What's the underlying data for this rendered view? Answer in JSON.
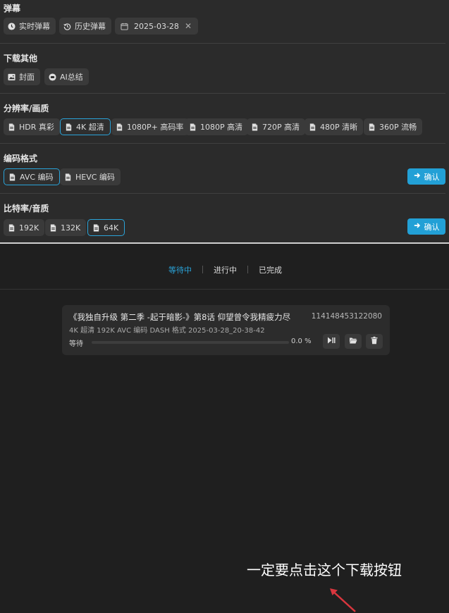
{
  "danmaku": {
    "title": "弹幕",
    "realtime_label": "实时弹幕",
    "history_label": "历史弹幕",
    "date_value": "2025-03-28"
  },
  "download_other": {
    "title": "下载其他",
    "cover_label": "封面",
    "ai_summary_label": "AI总结"
  },
  "resolution": {
    "title": "分辨率/画质",
    "options": [
      "HDR 真彩",
      "4K 超清",
      "1080P+ 高码率",
      "1080P 高清",
      "720P 高清",
      "480P 清晰",
      "360P 流畅"
    ],
    "selected": "4K 超清"
  },
  "codec": {
    "title": "编码格式",
    "options": [
      "AVC 编码",
      "HEVC 编码"
    ],
    "selected": "AVC 编码",
    "confirm_label": "确认"
  },
  "bitrate": {
    "title": "比特率/音质",
    "options": [
      "192K",
      "132K",
      "64K"
    ],
    "selected": "64K",
    "confirm_label": "确认"
  },
  "tabs": {
    "waiting": "等待中",
    "in_progress": "进行中",
    "completed": "已完成",
    "active": "等待中"
  },
  "task": {
    "title": "《我独自升级 第二季 -起于暗影-》第8话 仰望曾令我精疲力尽",
    "id": "114148453122080",
    "meta": "4K 超清   192K   AVC 编码   DASH 格式   2025-03-28_20-38-42",
    "status": "等待",
    "progress_percent": 0.0,
    "progress_text": "0.0 %"
  },
  "annotation": {
    "text": "一定要点击这个下载按钮"
  },
  "colors": {
    "accent": "#2aa3d8",
    "confirm_button": "#22a0d6",
    "arrow": "#d9363e"
  }
}
